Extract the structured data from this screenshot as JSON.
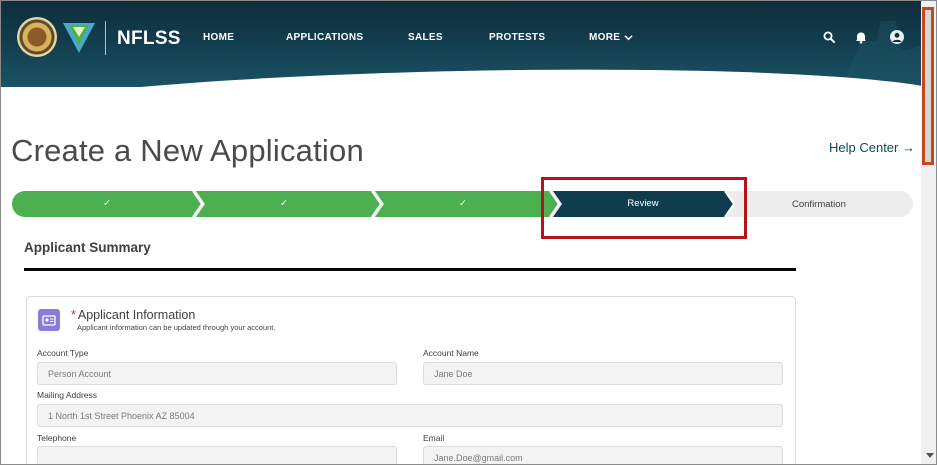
{
  "header": {
    "brand": "NFLSS",
    "nav": [
      "HOME",
      "APPLICATIONS",
      "SALES",
      "PROTESTS"
    ],
    "nav_more": "MORE",
    "icons": [
      "search-icon",
      "bell-icon",
      "user-avatar-icon",
      "chevron-down-icon"
    ]
  },
  "page": {
    "title": "Create a New Application",
    "help_center": "Help Center →"
  },
  "progress": {
    "steps": [
      {
        "label": "✓",
        "state": "complete"
      },
      {
        "label": "✓",
        "state": "complete"
      },
      {
        "label": "✓",
        "state": "complete"
      },
      {
        "label": "Review",
        "state": "current"
      },
      {
        "label": "Confirmation",
        "state": "upcoming"
      }
    ]
  },
  "summary": {
    "title": "Applicant Summary",
    "card": {
      "required_mark": "*",
      "title": "Applicant Information",
      "subtitle": "Applicant information can be updated through your account.",
      "fields": {
        "account_type": {
          "label": "Account Type",
          "value": "Person Account"
        },
        "account_name": {
          "label": "Account Name",
          "value": "Jane Doe"
        },
        "mailing_address": {
          "label": "Mailing Address",
          "value": "1 North 1st Street Phoenix AZ 85004"
        },
        "telephone": {
          "label": "Telephone",
          "value": ""
        },
        "email": {
          "label": "Email",
          "value": "Jane.Doe@gmail.com"
        }
      }
    }
  },
  "colors": {
    "header_dark": "#0f2e3c",
    "step_complete": "#4caf50",
    "step_current": "#0d3d4f",
    "highlight": "#b3141c",
    "scroll_highlight": "#c8471e"
  }
}
